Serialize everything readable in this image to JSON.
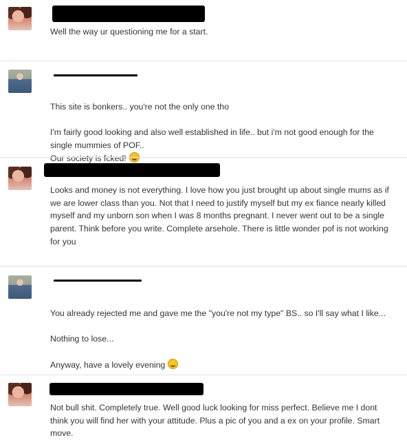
{
  "messages": [
    {
      "sender": "her",
      "text": "Well the way ur questioning me for a start."
    },
    {
      "sender": "him",
      "text": "This site is bonkers.. you're not the only one tho\n\nI'm fairly good looking and also well established in life.. but i'm not good enough for the single mummies of POF..\nOur society is fcked!",
      "emoji": "laughing-emoji-icon"
    },
    {
      "sender": "her",
      "text": "Looks and money is not everything. I love how you just brought up about single mums as if we are lower class than you. Not that I need to justify myself but my ex fiance nearly killed myself and my unborn son when I was 8 months pregnant. I never went out to be a single parent. Think before you write. Complete arsehole. There is little wonder pof is not working for you"
    },
    {
      "sender": "him",
      "text": "You already rejected me and gave me the \"you're not my type\" BS.. so I'll say what I like...\n\nNothing to lose...\n\nAnyway, have a lovely evening",
      "emoji": "yum-emoji-icon"
    },
    {
      "sender": "her",
      "text": "Not bull shit. Completely true. Well good luck looking for miss perfect. Believe me I dont think you will find her with your attitude. Plus a pic of you and a ex on your profile. Smart move."
    }
  ]
}
